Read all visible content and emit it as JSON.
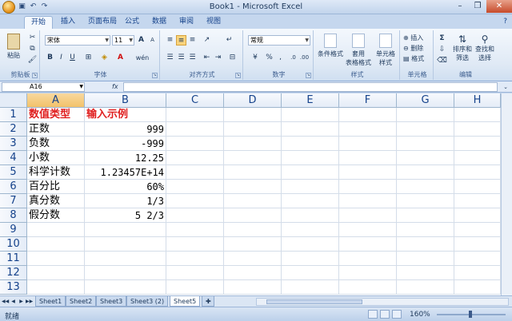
{
  "window": {
    "title": "Book1 - Microsoft Excel",
    "minimize": "–",
    "maximize": "❐",
    "close": "✕"
  },
  "ribbon_tabs": [
    "开始",
    "插入",
    "页面布局",
    "公式",
    "数据",
    "审阅",
    "视图"
  ],
  "ribbon_right": "?",
  "groups": {
    "clipboard": {
      "label": "剪贴板",
      "paste": "粘贴"
    },
    "font": {
      "label": "字体",
      "font_name": "宋体",
      "font_size": "11",
      "bold": "B",
      "italic": "I",
      "underline": "U",
      "grow": "A",
      "shrink": "A",
      "phonetic": "wén"
    },
    "alignment": {
      "label": "对齐方式"
    },
    "number": {
      "label": "数字",
      "format": "常规",
      "percent": "%",
      "comma": ","
    },
    "styles": {
      "label": "样式",
      "conditional": "条件格式",
      "table_format_1": "套用",
      "table_format_2": "表格格式",
      "cell_style_1": "单元格",
      "cell_style_2": "样式"
    },
    "cells": {
      "label": "单元格",
      "insert": "插入",
      "delete": "删除",
      "format": "格式"
    },
    "editing": {
      "label": "编辑",
      "sum": "Σ",
      "sort_1": "排序和",
      "sort_2": "筛选",
      "find_1": "查找和",
      "find_2": "选择"
    }
  },
  "formula_bar": {
    "name_box": "A16",
    "fx": "fx",
    "value": ""
  },
  "columns": [
    "A",
    "B",
    "C",
    "D",
    "E",
    "F",
    "G",
    "H"
  ],
  "rows": [
    "1",
    "2",
    "3",
    "4",
    "5",
    "6",
    "7",
    "8",
    "9",
    "10",
    "11",
    "12",
    "13"
  ],
  "cells": {
    "A": [
      "数值类型",
      "正数",
      "负数",
      "小数",
      "科学计数",
      "百分比",
      "真分数",
      "假分数"
    ],
    "B": [
      "输入示例",
      "999",
      "-999",
      "12.25",
      "1.23457E+14",
      "60%",
      "1/3",
      "5 2/3"
    ]
  },
  "sheet_tabs": [
    "Sheet1",
    "Sheet2",
    "Sheet3",
    "Sheet3 (2)",
    "Sheet5"
  ],
  "active_sheet": "Sheet5",
  "status": {
    "ready": "就绪",
    "zoom": "160%"
  }
}
